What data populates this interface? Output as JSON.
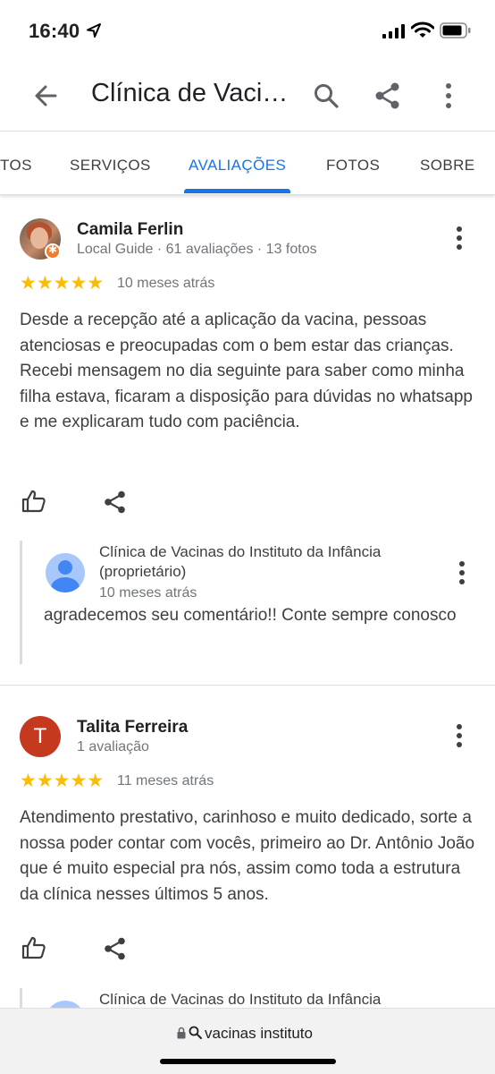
{
  "status": {
    "time": "16:40"
  },
  "appbar": {
    "title": "Clínica de Vacinas do Instituto da Infância"
  },
  "tabs": [
    "TOS",
    "SERVIÇOS",
    "AVALIAÇÕES",
    "FOTOS",
    "SOBRE"
  ],
  "active_tab": "AVALIAÇÕES",
  "reviews": [
    {
      "name": "Camila Ferlin",
      "meta": "Local Guide · 61 avaliações · 13 fotos",
      "rating": 5,
      "stars": "★★★★★",
      "date": "10 meses atrás",
      "text": "Desde a recepção até a aplicação da vacina, pessoas atenciosas e preocupadas com o bem estar das crianças. Recebi mensagem no dia seguinte para saber como minha filha estava, ficaram a disposição para dúvidas no whatsapp e me explicaram tudo com paciência.",
      "owner_reply": {
        "name": "Clínica de Vacinas do Instituto da Infância (proprietário)",
        "date": "10 meses atrás",
        "text": "agradecemos seu comentário!! Conte sempre conosco"
      }
    },
    {
      "name": "Talita Ferreira",
      "initial": "T",
      "meta": "1 avaliação",
      "rating": 5,
      "stars": "★★★★★",
      "date": "11 meses atrás",
      "text": "Atendimento prestativo, carinhoso e muito dedicado, sorte a nossa poder contar com vocês, primeiro ao Dr. Antônio João que é muito especial pra nós, assim como toda a estrutura da clínica nesses últimos 5 anos.",
      "owner_reply": {
        "name": "Clínica de Vacinas do Instituto da Infância"
      }
    }
  ],
  "urlbar": {
    "url": "vacinas instituto"
  },
  "colors": {
    "accent": "#1a73e8",
    "star": "#fbbc04",
    "avatar_t": "#c5391e"
  }
}
